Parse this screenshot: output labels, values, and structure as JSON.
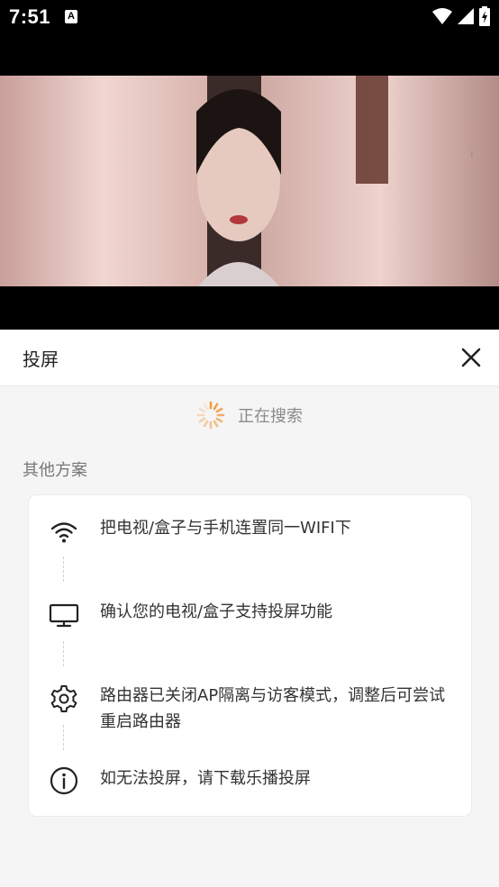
{
  "status_bar": {
    "time": "7:51",
    "notification_icon": "A"
  },
  "icons": {
    "wifi": "wifi-icon",
    "signal": "signal-icon",
    "battery": "battery-icon",
    "close": "close-icon",
    "spinner": "loading-spinner-icon",
    "tv": "tv-icon",
    "settings": "gear-icon",
    "info": "info-icon"
  },
  "panel": {
    "title": "投屏",
    "searching_label": "正在搜索",
    "section_title": "其他方案"
  },
  "steps": [
    {
      "icon": "wifi-icon",
      "text": "把电视/盒子与手机连置同一WIFI下"
    },
    {
      "icon": "tv-icon",
      "text": "确认您的电视/盒子支持投屏功能"
    },
    {
      "icon": "gear-icon",
      "text": "路由器已关闭AP隔离与访客模式，调整后可尝试重启路由器"
    },
    {
      "icon": "info-icon",
      "text": "如无法投屏，请下载乐播投屏"
    }
  ],
  "colors": {
    "spinner": "#f39a3c",
    "header_bg": "#ffffff",
    "panel_bg": "#f5f5f5"
  }
}
